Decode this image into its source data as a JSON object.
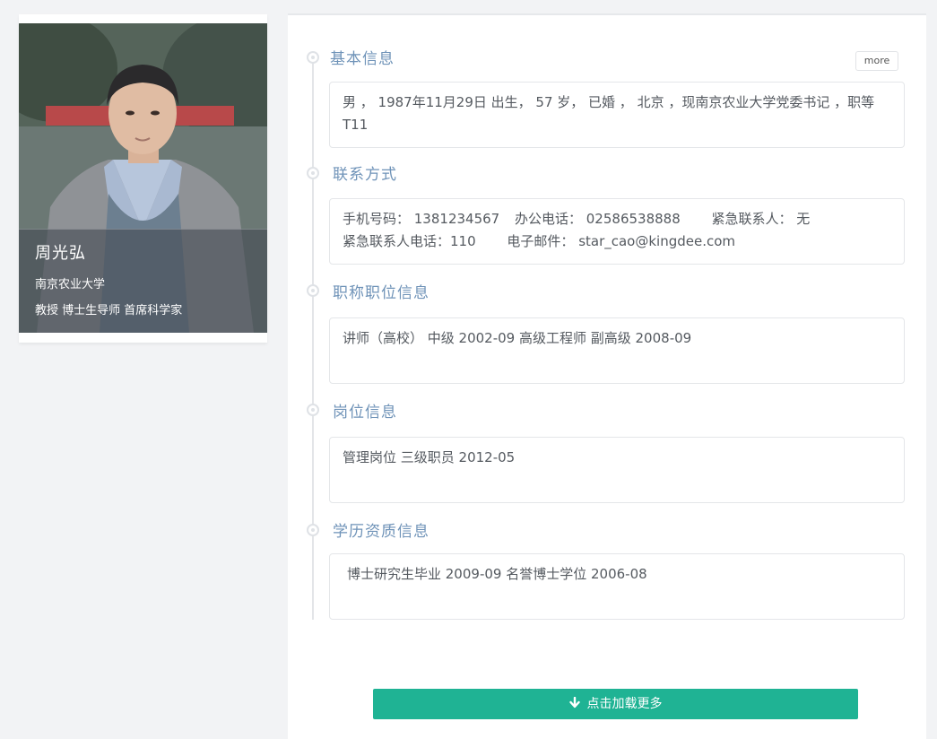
{
  "profile": {
    "name": "周光弘",
    "organization": "南京农业大学",
    "titles": "教授 博士生导师 首席科学家"
  },
  "more_label": "more",
  "sections": {
    "basic": {
      "title": "基本信息",
      "text": "男 ， 1987年11月29日 出生， 57 岁， 已婚 ， 北京 ，现南京农业大学党委书记 ，职等 T11"
    },
    "contact": {
      "title": "联系方式",
      "mobile": "手机号码： 1381234567",
      "office_phone": "办公电话： 02586538888",
      "emergency_contact": "紧急联系人： 无",
      "emergency_phone": "紧急联系人电话：110",
      "email": "电子邮件： star_cao@kingdee.com"
    },
    "title_position": {
      "title": "职称职位信息",
      "text": "讲师（高校） 中级 2002-09 高级工程师 副高级 2008-09"
    },
    "post": {
      "title": "岗位信息",
      "text": "管理岗位 三级职员 2012-05"
    },
    "education": {
      "title": "学历资质信息",
      "text": "博士研究生毕业 2009-09 名誉博士学位 2006-08"
    }
  },
  "load_more_label": "点击加载更多"
}
